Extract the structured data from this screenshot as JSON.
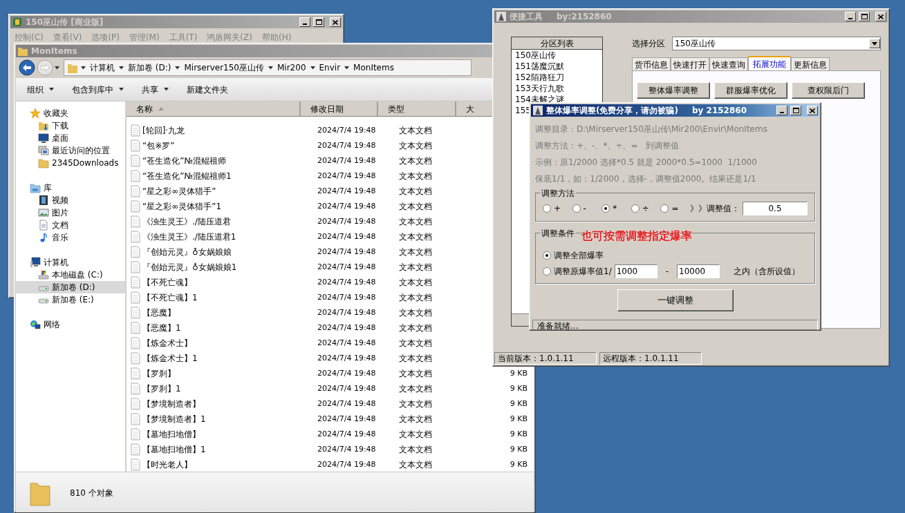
{
  "main_window": {
    "title": "150巫山传 [商业版]",
    "active": false,
    "menu": [
      "控制(C)",
      "查看(V)",
      "选项(P)",
      "管理(M)",
      "工具(T)",
      "鸿盾网关(Z)",
      "帮助(H)"
    ]
  },
  "explorer": {
    "title": "MonItems",
    "active": false,
    "breadcrumb": [
      "计算机",
      "新加卷 (D:)",
      "Mirserver150巫山传",
      "Mir200",
      "Envir",
      "MonItems"
    ],
    "toolbar": [
      {
        "label": "组织",
        "dropdown": true
      },
      {
        "label": "包含到库中",
        "dropdown": true
      },
      {
        "label": "共享",
        "dropdown": true
      },
      {
        "label": "新建文件夹",
        "dropdown": false
      }
    ],
    "nav": [
      {
        "label": "收藏夹",
        "kind": "star",
        "selected": false,
        "children": [
          {
            "label": "下载",
            "kind": "download",
            "selected": false
          },
          {
            "label": "桌面",
            "kind": "desktop",
            "selected": false
          },
          {
            "label": "最近访问的位置",
            "kind": "recent",
            "selected": false
          },
          {
            "label": "2345Downloads",
            "kind": "folder",
            "selected": false
          }
        ]
      },
      {
        "label": "库",
        "kind": "library",
        "selected": false,
        "children": [
          {
            "label": "视频",
            "kind": "video",
            "selected": false
          },
          {
            "label": "图片",
            "kind": "picture",
            "selected": false
          },
          {
            "label": "文档",
            "kind": "document",
            "selected": false
          },
          {
            "label": "音乐",
            "kind": "music",
            "selected": false
          }
        ]
      },
      {
        "label": "计算机",
        "kind": "computer",
        "selected": false,
        "children": [
          {
            "label": "本地磁盘 (C:)",
            "kind": "drive-system",
            "selected": false
          },
          {
            "label": "新加卷 (D:)",
            "kind": "drive",
            "selected": true
          },
          {
            "label": "新加卷 (E:)",
            "kind": "drive",
            "selected": false
          }
        ]
      },
      {
        "label": "网络",
        "kind": "network",
        "selected": false
      }
    ],
    "columns": [
      {
        "label": "名称",
        "sorted": true
      },
      {
        "label": "修改日期",
        "sorted": false
      },
      {
        "label": "类型",
        "sorted": false
      },
      {
        "label": "大",
        "sorted": false
      }
    ],
    "files": [
      {
        "name": "[轮回]·九龙",
        "date": "2024/7/4 19:48",
        "type": "文本文档"
      },
      {
        "name": "“包※罗”",
        "date": "2024/7/4 19:48",
        "type": "文本文档"
      },
      {
        "name": "“苍生造化”№混鲲祖师",
        "date": "2024/7/4 19:48",
        "type": "文本文档"
      },
      {
        "name": "“苍生造化”№混鲲祖师1",
        "date": "2024/7/4 19:48",
        "type": "文本文档"
      },
      {
        "name": "“星之彩∞灵体猎手”",
        "date": "2024/7/4 19:48",
        "type": "文本文档"
      },
      {
        "name": "“星之彩∞灵体猎手”1",
        "date": "2024/7/4 19:48",
        "type": "文本文档"
      },
      {
        "name": "《浊生灵王》./陆压道君",
        "date": "2024/7/4 19:48",
        "type": "文本文档"
      },
      {
        "name": "《浊生灵王》./陆压道君1",
        "date": "2024/7/4 19:48",
        "type": "文本文档"
      },
      {
        "name": "『创始元灵』♁女娲娘娘",
        "date": "2024/7/4 19:48",
        "type": "文本文档"
      },
      {
        "name": "『创始元灵』♁女娲娘娘1",
        "date": "2024/7/4 19:48",
        "type": "文本文档"
      },
      {
        "name": "【不死亡魂】",
        "date": "2024/7/4 19:48",
        "type": "文本文档"
      },
      {
        "name": "【不死亡魂】1",
        "date": "2024/7/4 19:48",
        "type": "文本文档"
      },
      {
        "name": "【恶魔】",
        "date": "2024/7/4 19:48",
        "type": "文本文档"
      },
      {
        "name": "【恶魔】1",
        "date": "2024/7/4 19:48",
        "type": "文本文档"
      },
      {
        "name": "【炼金术士】",
        "date": "2024/7/4 19:48",
        "type": "文本文档"
      },
      {
        "name": "【炼金术士】1",
        "date": "2024/7/4 19:48",
        "type": "文本文档"
      },
      {
        "name": "【罗刹】",
        "date": "2024/7/4 19:48",
        "type": "文本文档",
        "size": "9 KB"
      },
      {
        "name": "【罗刹】1",
        "date": "2024/7/4 19:48",
        "type": "文本文档",
        "size": "9 KB"
      },
      {
        "name": "【梦境制造者】",
        "date": "2024/7/4 19:48",
        "type": "文本文档",
        "size": "9 KB"
      },
      {
        "name": "【梦境制造者】1",
        "date": "2024/7/4 19:48",
        "type": "文本文档",
        "size": "9 KB"
      },
      {
        "name": "【墓地扫地僧】",
        "date": "2024/7/4 19:48",
        "type": "文本文档",
        "size": "9 KB"
      },
      {
        "name": "【墓地扫地僧】1",
        "date": "2024/7/4 19:48",
        "type": "文本文档",
        "size": "9 KB"
      },
      {
        "name": "【时光老人】",
        "date": "2024/7/4 19:48",
        "type": "文本文档",
        "size": "9 KB"
      }
    ],
    "status": "810 个对象"
  },
  "tool_window": {
    "title": "便捷工具",
    "author": "by:2152860",
    "active": false,
    "list_header": "分区列表",
    "partitions": [
      "150巫山传",
      "151荡魔沉默",
      "152陌路狂刀",
      "153天行九歌",
      "154未解之谜",
      "155"
    ],
    "select_label": "选择分区",
    "select_value": "150巫山传",
    "tabs": [
      {
        "label": "货币信息",
        "selected": false
      },
      {
        "label": "快速打开",
        "selected": false
      },
      {
        "label": "快速查询",
        "selected": false
      },
      {
        "label": "拓展功能",
        "selected": true
      },
      {
        "label": "更新信息",
        "selected": false
      }
    ],
    "buttons": [
      "整体爆率调整",
      "群服爆率优化",
      "查权限后门"
    ],
    "status": [
      "当前版本：1.0.1.11",
      "远程版本：1.0.1.11"
    ]
  },
  "dialog": {
    "title": "整体爆率调整(免费分享，请勿被骗)",
    "author": "by 2152860",
    "active": true,
    "info": [
      "调整目录：D:\\Mirserver150巫山传\\Mir200\\Envir\\MonItems",
      "调整方法：+、-、*、÷、=   到调整值",
      "示例：原1/2000 选择*0.5 就是 2000*0.5=1000  1/1000",
      "保底1/1，如：1/2000，选择-，调整值2000。结果还是1/1"
    ],
    "method": {
      "title": "调整方法",
      "options": [
        {
          "label": "+",
          "selected": false
        },
        {
          "label": "-",
          "selected": false
        },
        {
          "label": "*",
          "selected": true
        },
        {
          "label": "÷",
          "selected": false
        },
        {
          "label": "=",
          "selected": false
        }
      ],
      "value_label": "》》调整值：",
      "value": "0.5"
    },
    "conditions": {
      "title": "调整条件",
      "annotation": "也可按需调整指定爆率",
      "options": [
        {
          "kind": "plain",
          "label": "调整全部爆率",
          "selected": true
        },
        {
          "kind": "range",
          "label": "调整原爆率值1/",
          "selected": false,
          "from": "1000",
          "separator": "-",
          "to": "10000",
          "suffix": "之内（含所设值）"
        }
      ]
    },
    "button": "一键调整",
    "status": "准备就绪..."
  }
}
